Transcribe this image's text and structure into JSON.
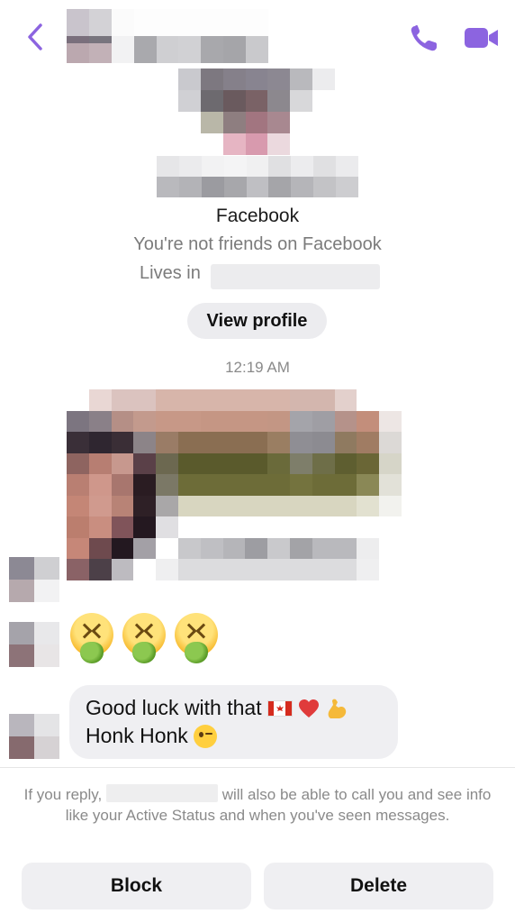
{
  "header": {
    "back_icon": "chevron-left-icon",
    "call_icon": "phone-icon",
    "video_icon": "video-camera-icon",
    "accent_color": "#8c64e0"
  },
  "profile": {
    "platform": "Facebook",
    "friend_status": "You're not friends on Facebook",
    "lives_label": "Lives in",
    "view_profile_label": "View profile"
  },
  "conversation": {
    "timestamp": "12:19 AM",
    "emoji_message": "🤮🤮🤮",
    "text_message": {
      "line1": "Good luck with that",
      "line2": "Honk Honk"
    }
  },
  "footer": {
    "notice_prefix": "If you reply,",
    "notice_suffix": "will also be able to call you and see info like your Active Status and when you've seen messages.",
    "block_label": "Block",
    "delete_label": "Delete"
  }
}
